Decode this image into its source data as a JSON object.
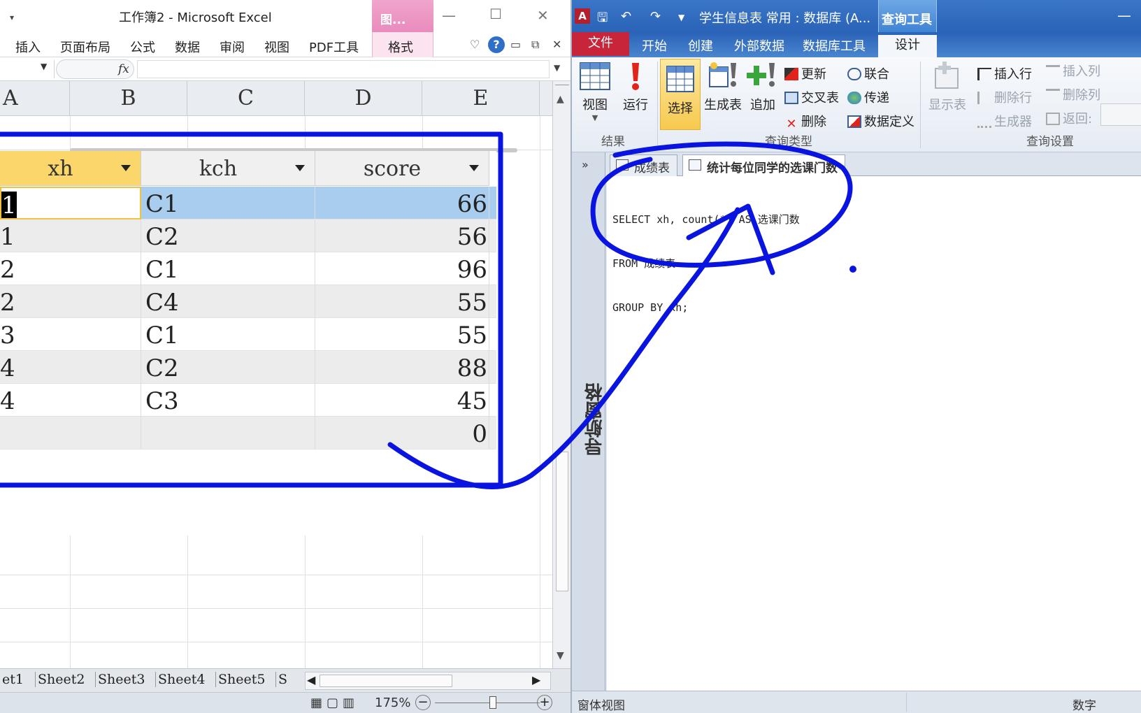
{
  "excel": {
    "title": "工作簿2 - Microsoft Excel",
    "quick_access": "▾",
    "context_tab_group": "图...",
    "menu_tabs": [
      "插入",
      "页面布局",
      "公式",
      "数据",
      "审阅",
      "视图",
      "PDF工具"
    ],
    "format_tab": "格式",
    "help_symbol": "?",
    "fx_symbol": "fx",
    "column_headers": [
      "A",
      "B",
      "C",
      "D",
      "E"
    ],
    "table": {
      "headers": [
        "xh",
        "kch",
        "score"
      ],
      "rows": [
        {
          "xh": "1",
          "kch": "C1",
          "score": "66"
        },
        {
          "xh": "1",
          "kch": "C2",
          "score": "56"
        },
        {
          "xh": "2",
          "kch": "C1",
          "score": "96"
        },
        {
          "xh": "2",
          "kch": "C4",
          "score": "55"
        },
        {
          "xh": "3",
          "kch": "C1",
          "score": "55"
        },
        {
          "xh": "4",
          "kch": "C2",
          "score": "88"
        },
        {
          "xh": "4",
          "kch": "C3",
          "score": "45"
        },
        {
          "xh": "",
          "kch": "",
          "score": "0"
        }
      ]
    },
    "sheet_tabs": [
      "et1",
      "Sheet2",
      "Sheet3",
      "Sheet4",
      "Sheet5",
      "S"
    ],
    "zoom": "175%",
    "zoom_minus": "−",
    "zoom_plus": "+"
  },
  "access": {
    "logo": "A",
    "title": "学生信息表 常用 : 数据库 (A...",
    "context_tab_group": "查询工具",
    "file_tab": "文件",
    "tabs": [
      "开始",
      "创建",
      "外部数据",
      "数据库工具"
    ],
    "design_tab": "设计",
    "ribbon": {
      "view": "视图",
      "run": "运行",
      "select": "选择",
      "make_table": "生成表",
      "append": "追加",
      "update": "更新",
      "crosstab": "交叉表",
      "delete": "删除",
      "union": "联合",
      "pass_through": "传递",
      "data_definition": "数据定义",
      "show_table": "显示表",
      "insert_rows": "插入行",
      "delete_rows": "删除行",
      "builder": "生成器",
      "insert_cols": "插入列",
      "delete_cols": "删除列",
      "return": "返回:",
      "group_results": "结果",
      "group_query_type": "查询类型",
      "group_query_setup": "查询设置"
    },
    "nav_pane_label": "导航窗格",
    "doc_tabs": [
      "成绩表",
      "统计每位同学的选课门数"
    ],
    "sql_lines": [
      "SELECT xh, count(*) AS 选课门数",
      "FROM 成绩表",
      "GROUP BY xh;"
    ],
    "status_left": "窗体视图",
    "status_right": "数字"
  },
  "colors": {
    "annotation": "#0a14e0",
    "access_title_bar": "#2a63b7",
    "access_file_tab": "#c8253b",
    "excel_context_tab": "#e98bbd",
    "selected_row": "#a9cdee",
    "header_highlight": "#fbd66a"
  }
}
